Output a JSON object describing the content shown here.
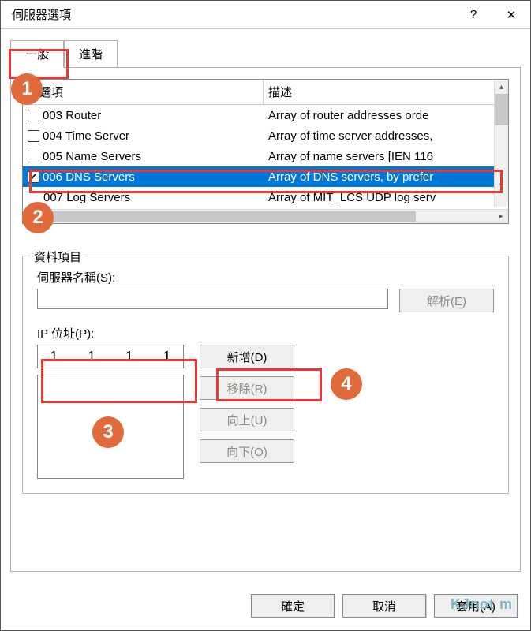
{
  "window": {
    "title": "伺服器選項"
  },
  "tabs": {
    "general": "一般",
    "advanced": "進階"
  },
  "list": {
    "header_option": "用選項",
    "header_desc": "描述",
    "rows": [
      {
        "code": "003 Router",
        "desc": "Array of router addresses orde",
        "checked": false
      },
      {
        "code": "004 Time Server",
        "desc": "Array of time server addresses,",
        "checked": false
      },
      {
        "code": "005 Name Servers",
        "desc": "Array of name servers [IEN 116",
        "checked": false
      },
      {
        "code": "006 DNS Servers",
        "desc": "Array of DNS servers, by prefer",
        "checked": true
      },
      {
        "code": "007 Log Servers",
        "desc": "Array of MIT_LCS UDP log serv",
        "checked": false
      }
    ]
  },
  "fieldset": {
    "legend": "資料項目",
    "server_name_label": "伺服器名稱(S):",
    "resolve_btn": "解析(E)",
    "ip_label": "IP 位址(P):",
    "ip_value": [
      "1",
      "1",
      "1",
      "1"
    ],
    "add_btn": "新增(D)",
    "remove_btn": "移除(R)",
    "up_btn": "向上(U)",
    "down_btn": "向下(O)"
  },
  "buttons": {
    "ok": "確定",
    "cancel": "取消",
    "apply": "套用(A)"
  },
  "badges": {
    "b1": "1",
    "b2": "2",
    "b3": "3",
    "b4": "4"
  },
  "watermark": "KJnot       m"
}
